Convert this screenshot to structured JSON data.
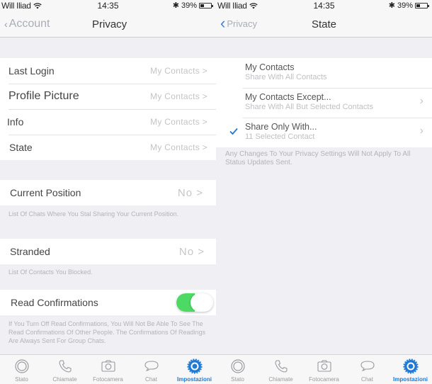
{
  "status_bar": {
    "carrier": "Will Iliad",
    "time": "14:35",
    "battery_text": "39%",
    "battery_level": 0.39
  },
  "left": {
    "nav": {
      "back_label": "Account",
      "title": "Privacy"
    },
    "privacy_rows": [
      {
        "label": "Last Login",
        "value": "My Contacts >"
      },
      {
        "label": "Profile Picture",
        "value": "My Contacts >"
      },
      {
        "label": "Info",
        "value": "My Contacts >"
      },
      {
        "label": "State",
        "value": "My Contacts >"
      }
    ],
    "current_position": {
      "label": "Current Position",
      "value": "No >"
    },
    "current_position_note": "List Of Chats Where You Stal Sharing Your Current Position.",
    "stranded": {
      "label": "Stranded",
      "value": "No >"
    },
    "stranded_note": "List Of Contacts You Blocked.",
    "read_confirmations": {
      "label": "Read Confirmations",
      "enabled": true
    },
    "read_confirmations_note": "If You Turn Off Read Confirmations, You Will Not Be Able To See The Read Confirmations Of Other People. The Confirmations Of Readings Are Always Sent For Group Chats."
  },
  "right": {
    "nav": {
      "back_label": "Privacy",
      "title": "State"
    },
    "options": [
      {
        "title": "My Contacts",
        "subtitle": "Share With All Contacts",
        "selected": false,
        "has_chevron": false
      },
      {
        "title": "My Contacts Except...",
        "subtitle": "Share With All But Selected Contacts",
        "selected": false,
        "has_chevron": true
      },
      {
        "title": "Share Only With...",
        "subtitle": "11 Selected Contact",
        "selected": true,
        "has_chevron": true
      }
    ],
    "note": "Any Changes To Your Privacy Settings Will Not Apply To All Status Updates Sent."
  },
  "tabbar": {
    "left": [
      {
        "label": "Stato",
        "icon": "status-icon",
        "active": false
      },
      {
        "label": "Chiamate",
        "icon": "phone-icon",
        "active": false
      },
      {
        "label": "Fotocamera",
        "icon": "camera-icon",
        "active": false
      },
      {
        "label": "Chat",
        "icon": "chat-icon",
        "active": false
      },
      {
        "label": "Impostazioni",
        "icon": "settings-icon",
        "active": true
      }
    ],
    "right": [
      {
        "label": "Stato",
        "icon": "status-icon",
        "active": false
      },
      {
        "label": "Chiamate",
        "icon": "phone-icon",
        "active": false
      },
      {
        "label": "Fotocamera",
        "icon": "camera-icon",
        "active": false
      },
      {
        "label": "Chat",
        "icon": "chat-icon",
        "active": false
      },
      {
        "label": "Impostazioni",
        "icon": "settings-icon",
        "active": true
      }
    ]
  },
  "colors": {
    "accent": "#1f7ad6",
    "toggle_on": "#4cd964",
    "background": "#efeff4"
  }
}
